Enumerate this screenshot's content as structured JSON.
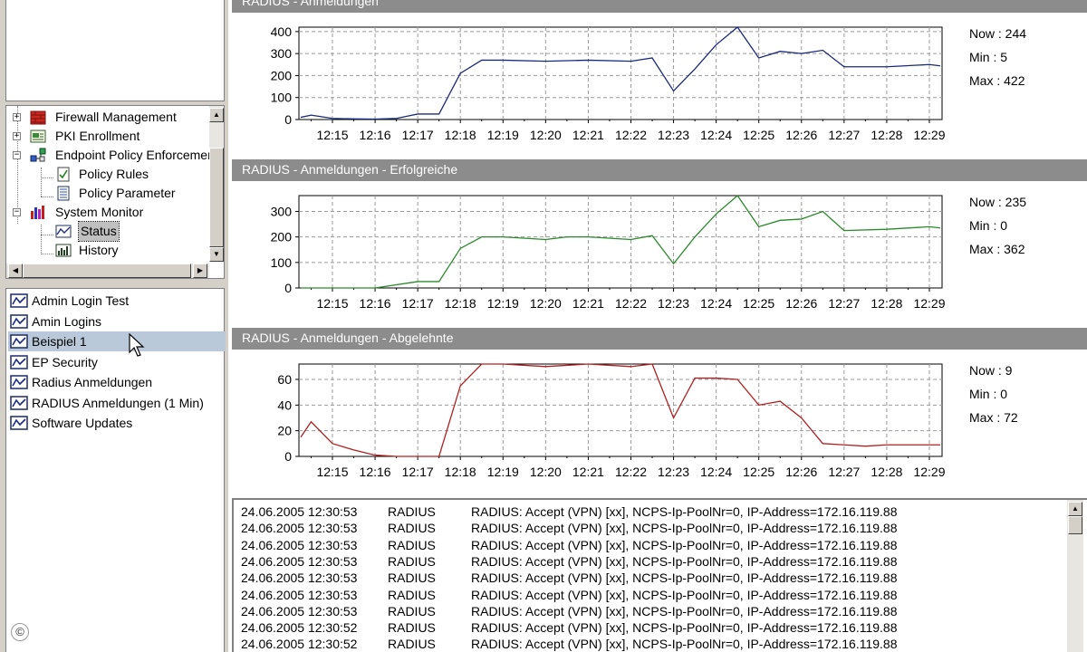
{
  "tree": {
    "items": [
      {
        "label": "Firewall Management",
        "icon": "firewall-icon"
      },
      {
        "label": "PKI Enrollment",
        "icon": "certificate-icon"
      },
      {
        "label": "Endpoint Policy Enforcement",
        "icon": "network-policy-icon"
      },
      {
        "label": "Policy Rules",
        "icon": "checklist-icon"
      },
      {
        "label": "Policy Parameter",
        "icon": "document-icon"
      },
      {
        "label": "System Monitor",
        "icon": "bar-chart-icon"
      },
      {
        "label": "Status",
        "icon": "line-chart-icon",
        "selected": true
      },
      {
        "label": "History",
        "icon": "histogram-icon"
      }
    ]
  },
  "monitor_list": {
    "items": [
      {
        "label": "Admin Login Test",
        "icon": "monitor-chart-icon"
      },
      {
        "label": "Amin Logins",
        "icon": "monitor-chart-icon"
      },
      {
        "label": "Beispiel 1",
        "icon": "monitor-chart-icon",
        "selected": true
      },
      {
        "label": "EP Security",
        "icon": "monitor-chart-icon"
      },
      {
        "label": "Radius Anmeldungen",
        "icon": "monitor-chart-icon"
      },
      {
        "label": "RADIUS Anmeldungen (1 Min)",
        "icon": "monitor-chart-icon"
      },
      {
        "label": "Software Updates",
        "icon": "monitor-chart-icon"
      }
    ]
  },
  "copyright_symbol": "©",
  "colors": {
    "blue_series": "#1a2a7a",
    "green_series": "#2a8a2a",
    "red_series": "#b02020",
    "header_bg": "#8c8c8c",
    "selected_row": "#b9c9d9"
  },
  "chart_data": [
    {
      "type": "line",
      "title": "RADIUS - Anmeldungen",
      "x": [
        "12:15",
        "12:16",
        "12:17",
        "12:18",
        "12:19",
        "12:20",
        "12:21",
        "12:22",
        "12:23",
        "12:24",
        "12:25",
        "12:26",
        "12:27",
        "12:28",
        "12:29"
      ],
      "ylim": [
        0,
        420
      ],
      "yticks": [
        0,
        100,
        200,
        300,
        400
      ],
      "color": "#1a2a7a",
      "points": [
        [
          12.0,
          10
        ],
        [
          12.5,
          20
        ],
        [
          13.0,
          5
        ],
        [
          13.5,
          3
        ],
        [
          14.0,
          2
        ],
        [
          14.5,
          5
        ],
        [
          15.0,
          25
        ],
        [
          15.5,
          25
        ],
        [
          16.0,
          210
        ],
        [
          16.5,
          270
        ],
        [
          17.0,
          270
        ],
        [
          18.0,
          265
        ],
        [
          19.0,
          270
        ],
        [
          20.0,
          265
        ],
        [
          20.5,
          280
        ],
        [
          21.0,
          130
        ],
        [
          21.5,
          230
        ],
        [
          22.0,
          340
        ],
        [
          22.5,
          422
        ],
        [
          23.0,
          280
        ],
        [
          23.5,
          310
        ],
        [
          24.0,
          300
        ],
        [
          24.5,
          315
        ],
        [
          25.0,
          240
        ],
        [
          26.0,
          240
        ],
        [
          27.0,
          250
        ],
        [
          27.5,
          244
        ]
      ],
      "stats": {
        "now": "Now : 244",
        "min": "Min : 5",
        "max": "Max : 422"
      }
    },
    {
      "type": "line",
      "title": "RADIUS - Anmeldungen - Erfolgreiche",
      "x": [
        "12:15",
        "12:16",
        "12:17",
        "12:18",
        "12:19",
        "12:20",
        "12:21",
        "12:22",
        "12:23",
        "12:24",
        "12:25",
        "12:26",
        "12:27",
        "12:28",
        "12:29"
      ],
      "ylim": [
        0,
        362
      ],
      "yticks": [
        0,
        100,
        200,
        300
      ],
      "color": "#2a8a2a",
      "points": [
        [
          12.0,
          0
        ],
        [
          14.0,
          0
        ],
        [
          15.0,
          25
        ],
        [
          15.5,
          25
        ],
        [
          16.0,
          155
        ],
        [
          16.5,
          200
        ],
        [
          17.0,
          200
        ],
        [
          18.0,
          190
        ],
        [
          18.5,
          200
        ],
        [
          19.0,
          200
        ],
        [
          20.0,
          190
        ],
        [
          20.5,
          205
        ],
        [
          21.0,
          95
        ],
        [
          21.5,
          200
        ],
        [
          22.0,
          290
        ],
        [
          22.5,
          362
        ],
        [
          23.0,
          240
        ],
        [
          23.5,
          265
        ],
        [
          24.0,
          270
        ],
        [
          24.5,
          300
        ],
        [
          25.0,
          225
        ],
        [
          26.0,
          230
        ],
        [
          27.0,
          240
        ],
        [
          27.5,
          235
        ]
      ],
      "stats": {
        "now": "Now : 235",
        "min": "Min : 0",
        "max": "Max : 362"
      }
    },
    {
      "type": "line",
      "title": "RADIUS - Anmeldungen - Abgelehnte",
      "x": [
        "12:15",
        "12:16",
        "12:17",
        "12:18",
        "12:19",
        "12:20",
        "12:21",
        "12:22",
        "12:23",
        "12:24",
        "12:25",
        "12:26",
        "12:27",
        "12:28",
        "12:29"
      ],
      "ylim": [
        0,
        72
      ],
      "yticks": [
        0,
        20,
        40,
        60
      ],
      "color": "#b02020",
      "points": [
        [
          12.0,
          15
        ],
        [
          12.5,
          27
        ],
        [
          13.0,
          10
        ],
        [
          13.5,
          5
        ],
        [
          14.0,
          1
        ],
        [
          14.5,
          0
        ],
        [
          15.0,
          0
        ],
        [
          15.5,
          0
        ],
        [
          16.0,
          55
        ],
        [
          16.5,
          72
        ],
        [
          17.0,
          72
        ],
        [
          18.0,
          70
        ],
        [
          19.0,
          72
        ],
        [
          20.0,
          70
        ],
        [
          20.5,
          72
        ],
        [
          21.0,
          30
        ],
        [
          21.5,
          61
        ],
        [
          22.0,
          61
        ],
        [
          22.5,
          60
        ],
        [
          23.0,
          40
        ],
        [
          23.5,
          43
        ],
        [
          24.0,
          30
        ],
        [
          24.5,
          10
        ],
        [
          25.0,
          9
        ],
        [
          25.5,
          8
        ],
        [
          26.0,
          9
        ],
        [
          27.0,
          9
        ],
        [
          27.5,
          9
        ]
      ],
      "stats": {
        "now": "Now : 9",
        "min": "Min : 0",
        "max": "Max : 72"
      }
    }
  ],
  "log": {
    "rows": [
      [
        "24.06.2005 12:30:53",
        "RADIUS",
        "RADIUS: Accept (VPN) [xx], NCPS-Ip-PoolNr=0, IP-Address=172.16.119.88"
      ],
      [
        "24.06.2005 12:30:53",
        "RADIUS",
        "RADIUS: Accept (VPN) [xx], NCPS-Ip-PoolNr=0, IP-Address=172.16.119.88"
      ],
      [
        "24.06.2005 12:30:53",
        "RADIUS",
        "RADIUS: Accept (VPN) [xx], NCPS-Ip-PoolNr=0, IP-Address=172.16.119.88"
      ],
      [
        "24.06.2005 12:30:53",
        "RADIUS",
        "RADIUS: Accept (VPN) [xx], NCPS-Ip-PoolNr=0, IP-Address=172.16.119.88"
      ],
      [
        "24.06.2005 12:30:53",
        "RADIUS",
        "RADIUS: Accept (VPN) [xx], NCPS-Ip-PoolNr=0, IP-Address=172.16.119.88"
      ],
      [
        "24.06.2005 12:30:53",
        "RADIUS",
        "RADIUS: Accept (VPN) [xx], NCPS-Ip-PoolNr=0, IP-Address=172.16.119.88"
      ],
      [
        "24.06.2005 12:30:53",
        "RADIUS",
        "RADIUS: Accept (VPN) [xx], NCPS-Ip-PoolNr=0, IP-Address=172.16.119.88"
      ],
      [
        "24.06.2005 12:30:52",
        "RADIUS",
        "RADIUS: Accept (VPN) [xx], NCPS-Ip-PoolNr=0, IP-Address=172.16.119.88"
      ],
      [
        "24.06.2005 12:30:52",
        "RADIUS",
        "RADIUS: Accept (VPN) [xx], NCPS-Ip-PoolNr=0, IP-Address=172.16.119.88"
      ]
    ]
  }
}
